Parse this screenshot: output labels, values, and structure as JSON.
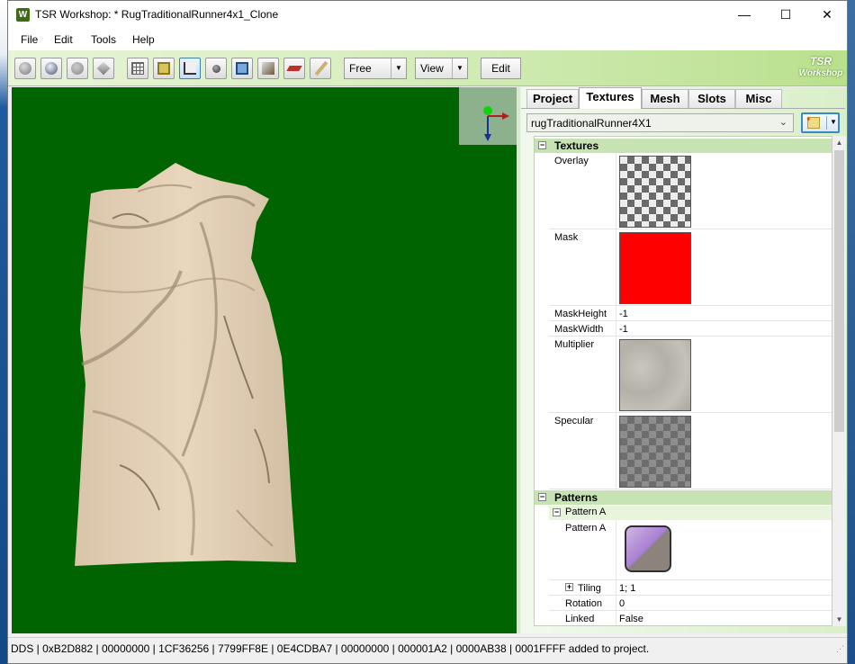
{
  "window": {
    "title": "TSR Workshop: * RugTraditionalRunner4x1_Clone",
    "app_icon_letter": "W",
    "minimize": "—",
    "maximize": "☐",
    "close": "✕"
  },
  "menu": [
    "File",
    "Edit",
    "Tools",
    "Help"
  ],
  "toolbar": {
    "camera_mode": "Free",
    "view_label": "View",
    "edit_label": "Edit",
    "logo_line1": "TSR",
    "logo_line2": "Workshop"
  },
  "tabs": [
    "Project",
    "Textures",
    "Mesh",
    "Slots",
    "Misc"
  ],
  "selected_tab": "Textures",
  "texture_select": "rugTraditionalRunner4X1",
  "properties": {
    "textures_category": "Textures",
    "overlay": "Overlay",
    "mask": "Mask",
    "mask_color": "#ff0000",
    "mask_height_label": "MaskHeight",
    "mask_height": "-1",
    "mask_width_label": "MaskWidth",
    "mask_width": "-1",
    "multiplier": "Multiplier",
    "specular": "Specular",
    "patterns_category": "Patterns",
    "pattern_a_group": "Pattern A",
    "pattern_a_label": "Pattern A",
    "tiling_label": "Tiling",
    "tiling": "1; 1",
    "rotation_label": "Rotation",
    "rotation": "0",
    "linked_label": "Linked",
    "linked": "False"
  },
  "status": "DDS | 0xB2D882 | 00000000 | 1CF36256 | 7799FF8E | 0E4CDBA7 | 00000000 | 000001A2 | 0000AB38 | 0001FFFF added to project.",
  "colors": {
    "viewport_bg": "#006400",
    "rug": "#e1cdb3",
    "category_bg": "#c8e3b3"
  }
}
